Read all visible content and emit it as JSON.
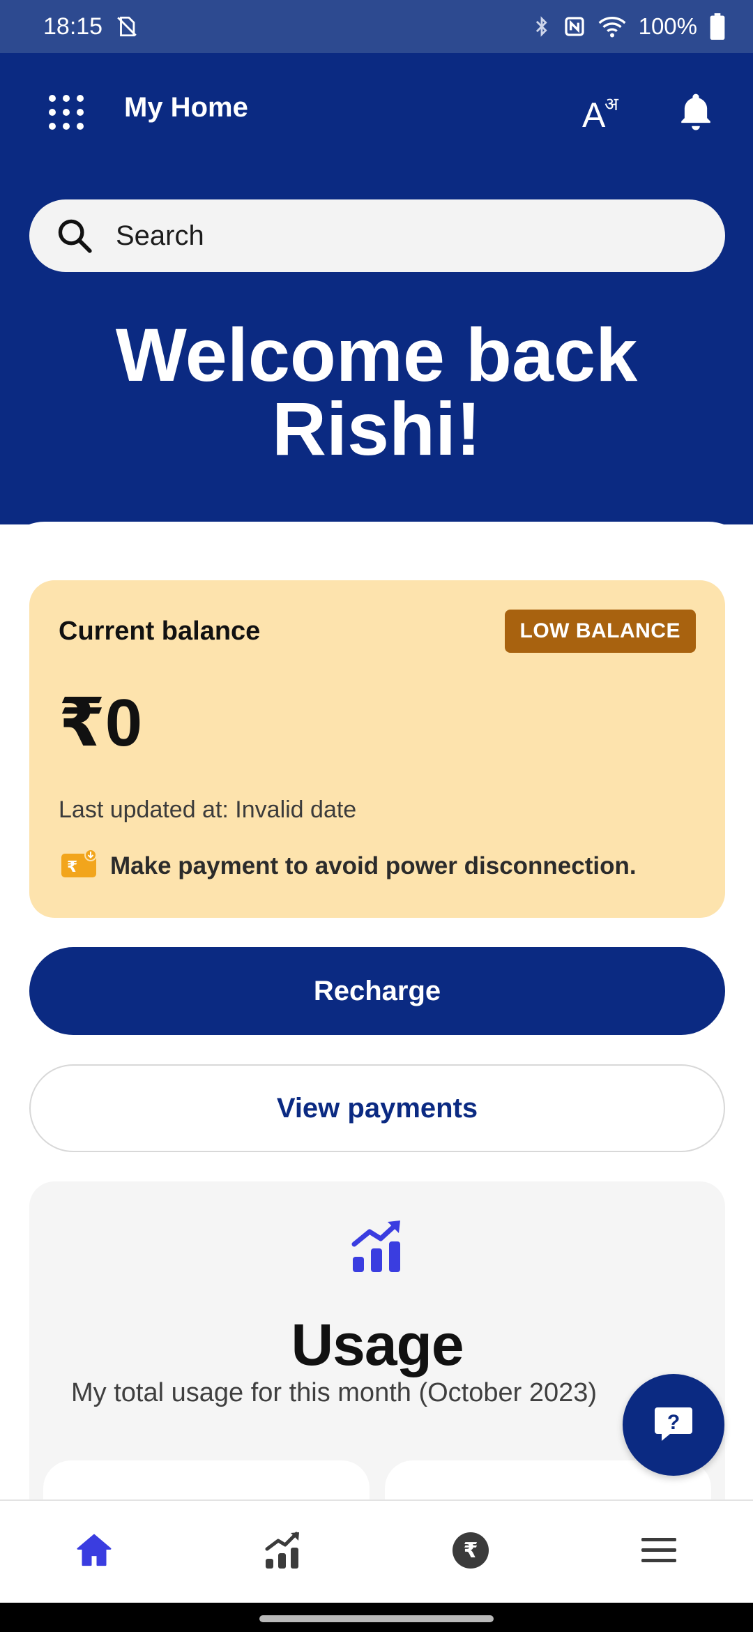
{
  "status_bar": {
    "time": "18:15",
    "battery": "100%",
    "icons": [
      "no-sim-icon",
      "bluetooth-icon",
      "nfc-icon",
      "wifi-icon",
      "battery-icon"
    ]
  },
  "header": {
    "title": "My Home",
    "menu_icon": "apps-grid-icon",
    "language_icon": "language-toggle-icon",
    "notification_icon": "bell-icon",
    "background": "#0b2a82"
  },
  "search": {
    "placeholder": "Search"
  },
  "welcome": {
    "line1": "Welcome back",
    "line2": "Rishi!"
  },
  "balance": {
    "label": "Current balance",
    "badge": "LOW BALANCE",
    "amount": "₹0",
    "last_updated": "Last updated at: Invalid date",
    "warning": "Make payment to avoid power disconnection.",
    "card_color": "#fde3ad",
    "badge_color": "#a8620f"
  },
  "actions": {
    "recharge": "Recharge",
    "view_payments": "View payments"
  },
  "usage": {
    "title": "Usage",
    "subtitle": "My total usage for this month (October 2023)",
    "icon": "usage-chart-icon",
    "icon_color": "#3a3de0"
  },
  "help_fab": {
    "icon": "help-chat-icon"
  },
  "bottom_nav": [
    {
      "name": "home",
      "icon": "home-icon",
      "active": true
    },
    {
      "name": "usage",
      "icon": "bar-chart-icon",
      "active": false
    },
    {
      "name": "payments",
      "icon": "rupee-icon",
      "active": false
    },
    {
      "name": "menu",
      "icon": "hamburger-menu-icon",
      "active": false
    }
  ]
}
